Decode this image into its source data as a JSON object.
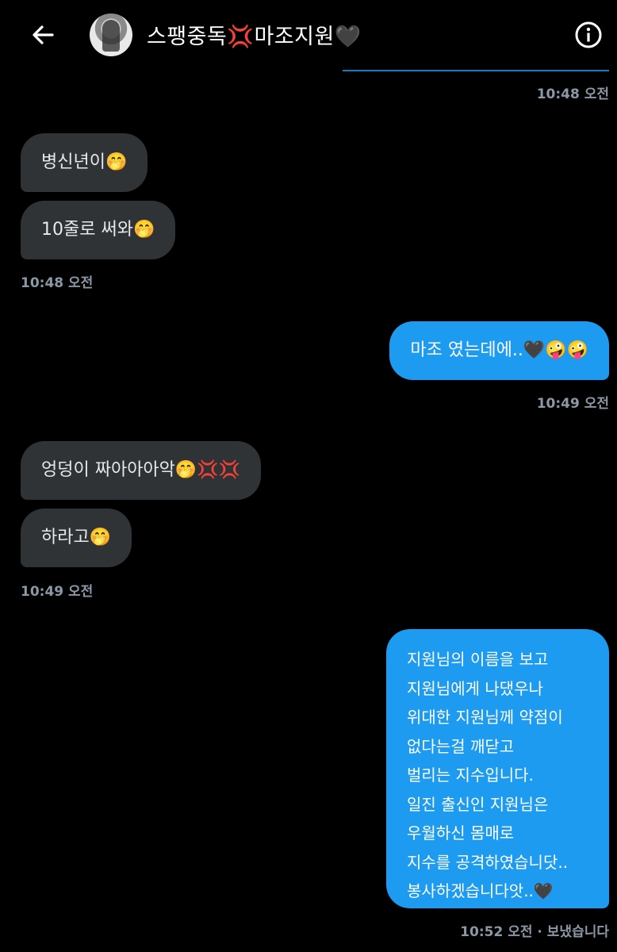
{
  "header": {
    "title": "스팽중독💢마조지원🖤",
    "back_icon": "arrow-left-icon",
    "info_icon": "info-icon"
  },
  "messages": [
    {
      "type": "timestamp",
      "side": "right",
      "text": "10:48 오전"
    },
    {
      "type": "message",
      "side": "left",
      "text": "병신년이🤭"
    },
    {
      "type": "message",
      "side": "left",
      "text": "10줄로 써와🤭"
    },
    {
      "type": "timestamp",
      "side": "left",
      "text": "10:48 오전"
    },
    {
      "type": "message",
      "side": "right",
      "text": "마조 였는데에..🖤🤪🤪"
    },
    {
      "type": "timestamp",
      "side": "right",
      "text": "10:49 오전"
    },
    {
      "type": "message",
      "side": "left",
      "text": "엉덩이 짜아아아악🤭💢💢"
    },
    {
      "type": "message",
      "side": "left",
      "text": "하라고🤭"
    },
    {
      "type": "timestamp",
      "side": "left",
      "text": "10:49 오전"
    },
    {
      "type": "message",
      "side": "right",
      "lines": [
        "지원님의 이름을 보고",
        "지원님에게 나댔우나",
        "위대한 지원님께 약점이",
        "없다는걸 깨닫고",
        "벌리는 지수입니다.",
        "일진 출신인 지원님은",
        "우월하신 몸매로",
        "지수를 공격하였습니닷..",
        "봉사하겠습니다앗..🖤"
      ]
    },
    {
      "type": "timestamp",
      "side": "right",
      "text": "10:52 오전 · 보냈습니다"
    }
  ],
  "colors": {
    "background": "#000000",
    "incoming_bubble": "#2f3336",
    "outgoing_bubble": "#1d9bf0",
    "timestamp": "#8b98a5"
  }
}
